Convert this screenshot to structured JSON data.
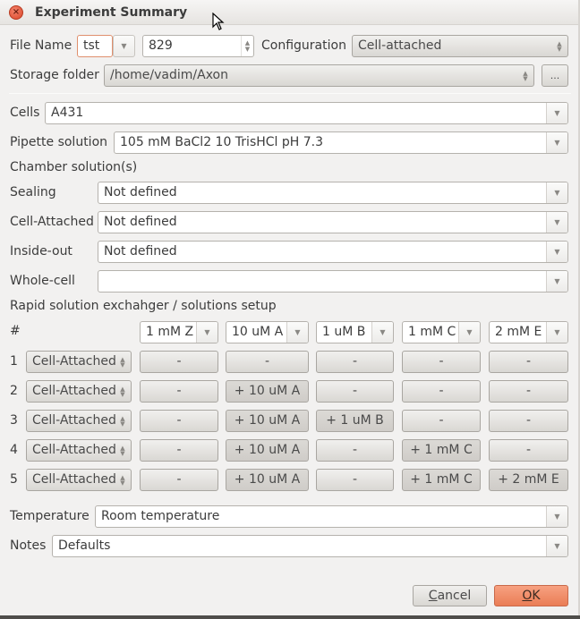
{
  "window": {
    "title": "Experiment Summary"
  },
  "file_name": {
    "label": "File Name",
    "prefix": "tst",
    "number": "829"
  },
  "configuration": {
    "label": "Configuration",
    "value": "Cell-attached"
  },
  "storage_folder": {
    "label": "Storage folder",
    "value": "/home/vadim/Axon",
    "browse_label": "..."
  },
  "cells": {
    "label": "Cells",
    "value": "A431"
  },
  "pipette_solution": {
    "label": "Pipette solution",
    "value": "105 mM BaCl2 10 TrisHCl pH 7.3"
  },
  "chamber": {
    "heading": "Chamber solution(s)",
    "rows": [
      {
        "label": "Sealing",
        "value": "Not defined"
      },
      {
        "label": "Cell-Attached",
        "value": "Not defined"
      },
      {
        "label": "Inside-out",
        "value": "Not defined"
      },
      {
        "label": "Whole-cell",
        "value": ""
      }
    ]
  },
  "rapid": {
    "heading": "Rapid solution exchahger / solutions setup",
    "hash_label": "#",
    "columns": [
      "1 mM Z",
      "10 uM A",
      "1 uM B",
      "1 mM C",
      "2 mM E"
    ],
    "rows": [
      {
        "num": "1",
        "config": "Cell-Attached",
        "cells": [
          "-",
          "-",
          "-",
          "-",
          "-"
        ]
      },
      {
        "num": "2",
        "config": "Cell-Attached",
        "cells": [
          "-",
          "+ 10 uM A",
          "-",
          "-",
          "-"
        ]
      },
      {
        "num": "3",
        "config": "Cell-Attached",
        "cells": [
          "-",
          "+ 10 uM A",
          "+ 1 uM B",
          "-",
          "-"
        ]
      },
      {
        "num": "4",
        "config": "Cell-Attached",
        "cells": [
          "-",
          "+ 10 uM A",
          "-",
          "+ 1 mM C",
          "-"
        ]
      },
      {
        "num": "5",
        "config": "Cell-Attached",
        "cells": [
          "-",
          "+ 10 uM A",
          "-",
          "+ 1 mM C",
          "+ 2 mM E"
        ]
      }
    ]
  },
  "temperature": {
    "label": "Temperature",
    "value": "Room temperature"
  },
  "notes": {
    "label": "Notes",
    "value": "Defaults"
  },
  "buttons": {
    "cancel_first": "C",
    "cancel_rest": "ancel",
    "ok_first": "O",
    "ok_rest": "K"
  },
  "colors": {
    "accent_ok": "#ea7d55",
    "close": "#d9452a"
  }
}
